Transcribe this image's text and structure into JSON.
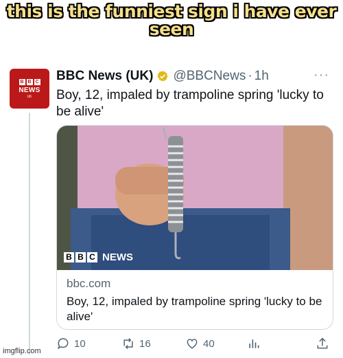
{
  "meme": {
    "caption_line1": "this is the funniest sign i have ever",
    "caption_line2": "seen"
  },
  "tweet": {
    "display_name": "BBC News (UK)",
    "handle": "@BBCNews",
    "separator": "·",
    "time": "1h",
    "more": "···",
    "avatar_letters": [
      "B",
      "B",
      "C"
    ],
    "avatar_news": "NEWS",
    "avatar_uk": "UK",
    "text": "Boy, 12, impaled by trampoline spring 'lucky to be alive'",
    "card": {
      "badge_letters": [
        "B",
        "B",
        "C"
      ],
      "badge_label": "NEWS",
      "domain": "bbc.com",
      "title": "Boy, 12, impaled by trampoline spring 'lucky to be alive'"
    },
    "actions": {
      "replies": "10",
      "reposts": "16",
      "likes": "40"
    }
  },
  "watermark": "imgflip.com",
  "colors": {
    "bbc_red": "#bb1919",
    "verified_gold": "#e2b719",
    "caption_fill": "#f5e08c"
  }
}
